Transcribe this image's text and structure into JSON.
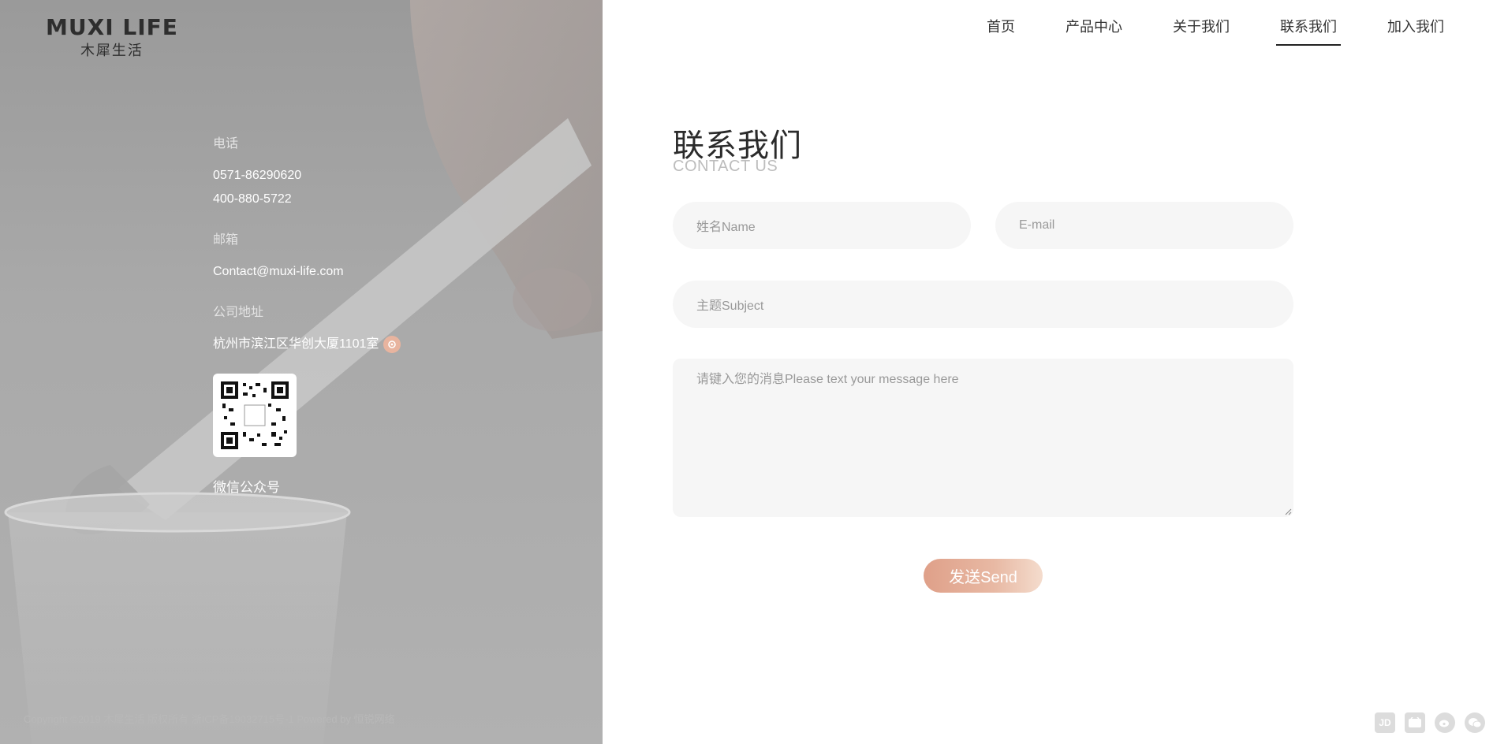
{
  "brand": {
    "name_en": "MUXI LIFE",
    "name_cn": "木犀生活"
  },
  "nav": {
    "items": [
      {
        "label": "首页"
      },
      {
        "label": "产品中心"
      },
      {
        "label": "关于我们"
      },
      {
        "label": "联系我们"
      },
      {
        "label": "加入我们"
      }
    ],
    "active_index": 3
  },
  "contact": {
    "phone_label": "电话",
    "phones": [
      "0571-86290620",
      "400-880-5722"
    ],
    "email_label": "邮箱",
    "email": "Contact@muxi-life.com",
    "address_label": "公司地址",
    "address": "杭州市滨江区华创大厦1101室",
    "qr_caption": "微信公众号"
  },
  "form": {
    "title_cn": "联系我们",
    "title_en": "CONTACT US",
    "name_placeholder": "姓名Name",
    "email_placeholder": "E-mail",
    "subject_placeholder": "主题Subject",
    "message_placeholder": "请键入您的消息Please text your message here",
    "send_label": "发送Send"
  },
  "footer": {
    "copyright": "Copyright ©2019 木犀生活 版权所有 浙ICP备19032715号-1 Powered by 恒锐网络",
    "social": [
      {
        "icon": "jd-icon",
        "text": "JD"
      },
      {
        "icon": "tmall-icon",
        "text": ""
      },
      {
        "icon": "weibo-icon",
        "text": ""
      },
      {
        "icon": "wechat-icon",
        "text": ""
      }
    ]
  },
  "colors": {
    "accent": "#e3a58d",
    "field_bg": "#f6f6f6",
    "panel": "#a9a9a9"
  }
}
